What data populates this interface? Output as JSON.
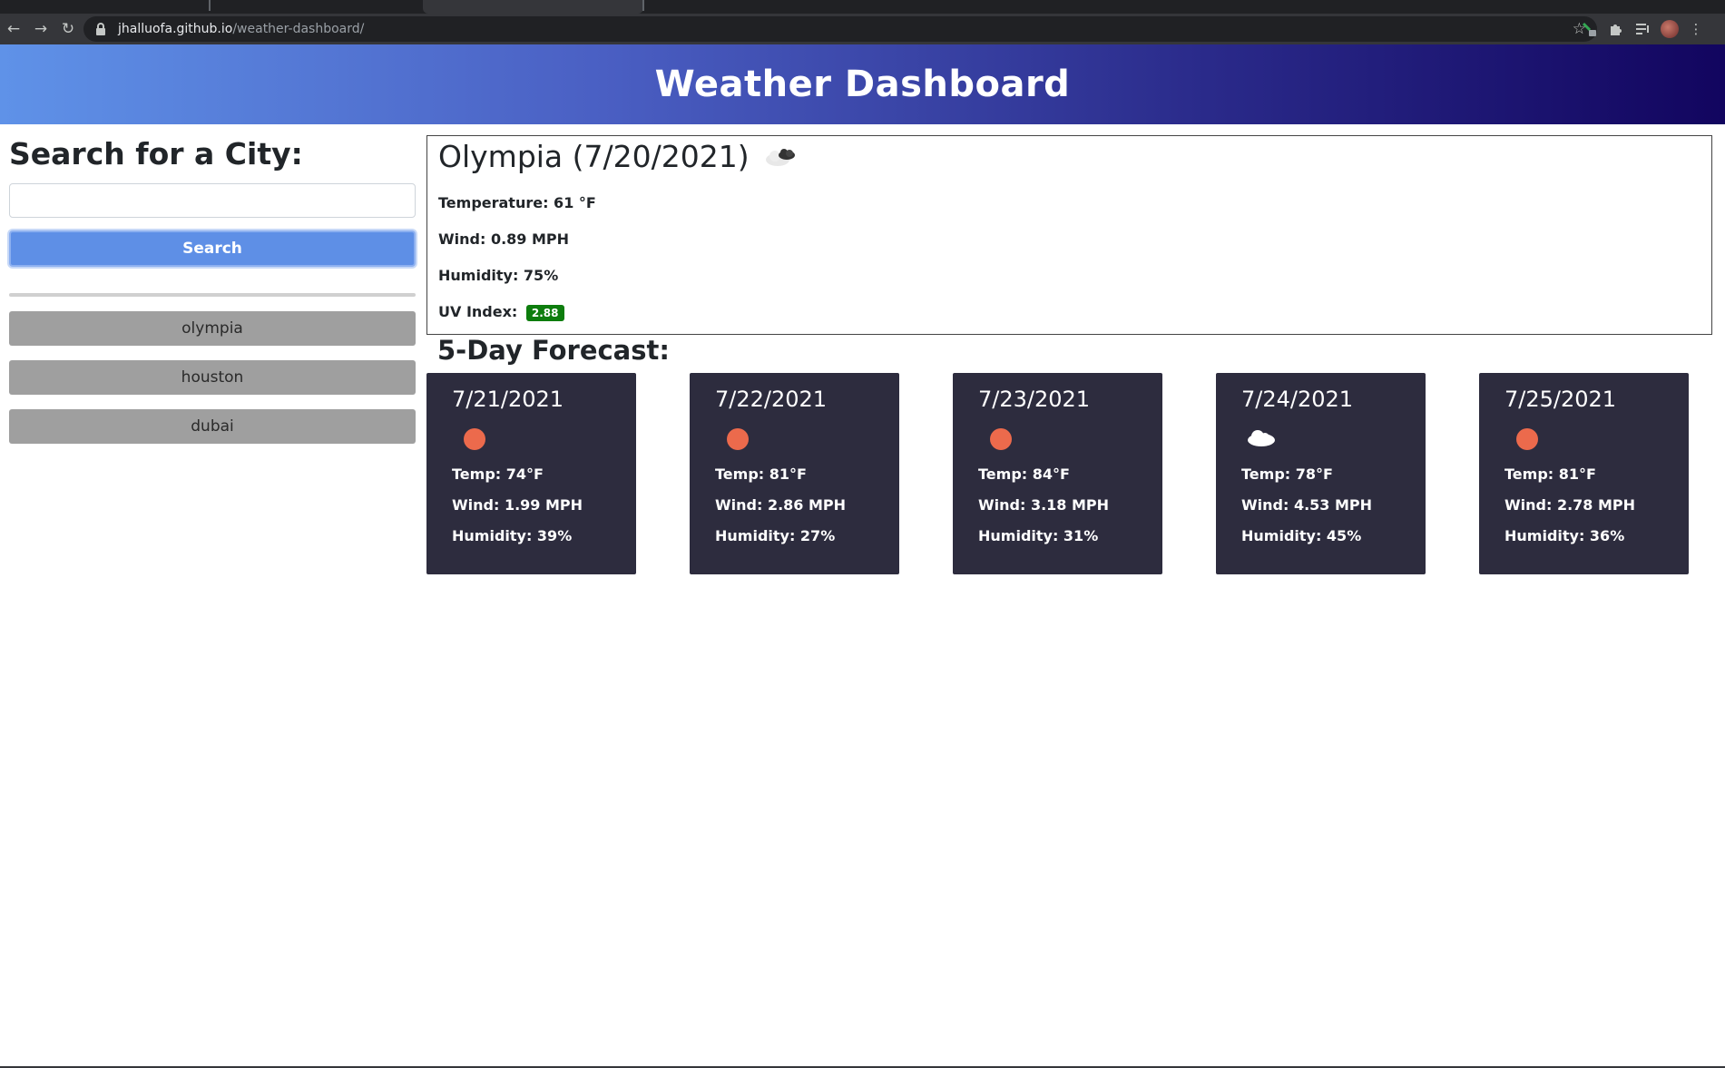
{
  "browser": {
    "url_host": "jhalluofa.github.io",
    "url_path": "/weather-dashboard/"
  },
  "header": {
    "title": "Weather Dashboard"
  },
  "sidebar": {
    "heading": "Search for a City:",
    "search_input_value": "",
    "search_button_label": "Search",
    "history": [
      {
        "label": "olympia"
      },
      {
        "label": "houston"
      },
      {
        "label": "dubai"
      }
    ]
  },
  "current": {
    "title": "Olympia (7/20/2021)",
    "icon": "broken-clouds-icon",
    "temperature": "Temperature: 61 °F",
    "wind": "Wind: 0.89 MPH",
    "humidity": "Humidity: 75%",
    "uv_label": "UV Index:",
    "uv_value": "2.88",
    "uv_color": "#0d7d0d"
  },
  "forecast": {
    "title": "5-Day Forecast:",
    "days": [
      {
        "date": "7/21/2021",
        "icon": "sun-icon",
        "temp": "Temp: 74°F",
        "wind": "Wind: 1.99 MPH",
        "humidity": "Humidity: 39%"
      },
      {
        "date": "7/22/2021",
        "icon": "sun-icon",
        "temp": "Temp: 81°F",
        "wind": "Wind: 2.86 MPH",
        "humidity": "Humidity: 27%"
      },
      {
        "date": "7/23/2021",
        "icon": "sun-icon",
        "temp": "Temp: 84°F",
        "wind": "Wind: 3.18 MPH",
        "humidity": "Humidity: 31%"
      },
      {
        "date": "7/24/2021",
        "icon": "cloud-icon",
        "temp": "Temp: 78°F",
        "wind": "Wind: 4.53 MPH",
        "humidity": "Humidity: 45%"
      },
      {
        "date": "7/25/2021",
        "icon": "sun-icon",
        "temp": "Temp: 81°F",
        "wind": "Wind: 2.78 MPH",
        "humidity": "Humidity: 36%"
      }
    ]
  },
  "colors": {
    "header_gradient_start": "#5f92e8",
    "header_gradient_end": "#12055f",
    "search_button": "#5e8fe6",
    "history_button": "#9f9f9f",
    "card_background": "#2d2c3e",
    "sun": "#ec6a4c"
  }
}
